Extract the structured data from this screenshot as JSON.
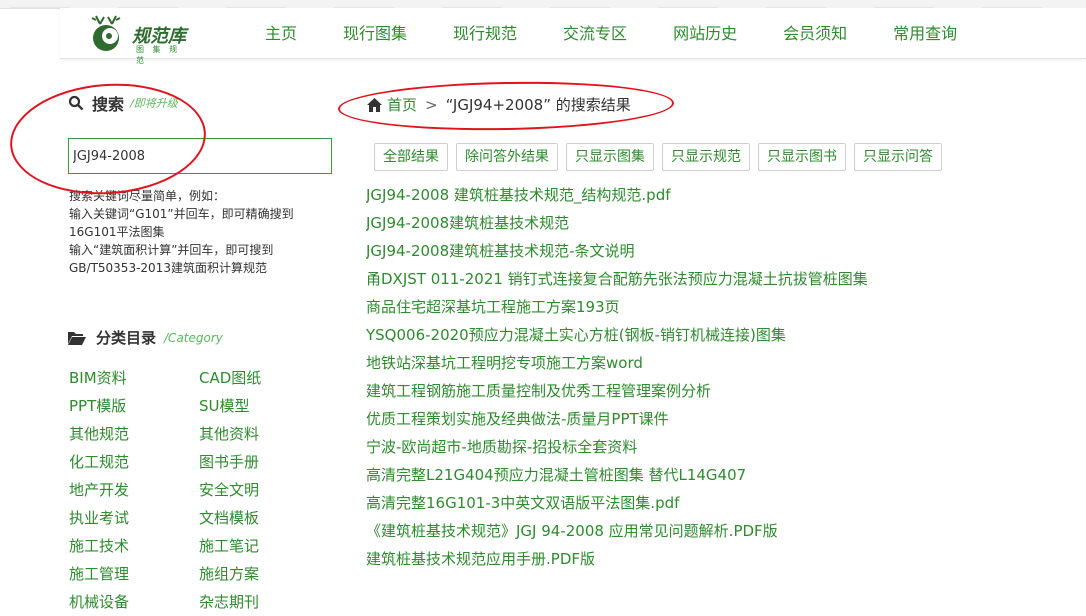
{
  "nav": {
    "logo_text": "规范库",
    "logo_sub": "图 集 规 范",
    "items": [
      "主页",
      "现行图集",
      "现行规范",
      "交流专区",
      "网站历史",
      "会员须知",
      "常用查询"
    ]
  },
  "search": {
    "title": "搜索",
    "subtitle": "/即将升级",
    "value": "JGJ94-2008",
    "tips": [
      "搜索关键词尽量简单，例如：",
      "输入关键词“G101”并回车，即可精确搜到16G101平法图集",
      "输入“建筑面积计算”并回车，即可搜到GB/T50353-2013建筑面积计算规范"
    ]
  },
  "categories": {
    "title": "分类目录",
    "subtitle": "/Category",
    "items": [
      "BIM资料",
      "CAD图纸",
      "PPT模版",
      "SU模型",
      "其他规范",
      "其他资料",
      "化工规范",
      "图书手册",
      "地产开发",
      "安全文明",
      "执业考试",
      "文档模板",
      "施工技术",
      "施工笔记",
      "施工管理",
      "施组方案",
      "机械设备",
      "杂志期刊"
    ]
  },
  "breadcrumb": {
    "home": "首页",
    "separator": ">",
    "query_text": "“JGJ94+2008” 的搜索结果"
  },
  "filters": [
    "全部结果",
    "除问答外结果",
    "只显示图集",
    "只显示规范",
    "只显示图书",
    "只显示问答"
  ],
  "results": [
    "JGJ94-2008 建筑桩基技术规范_结构规范.pdf",
    "JGJ94-2008建筑桩基技术规范",
    "JGJ94-2008建筑桩基技术规范-条文说明",
    "甬DXJST 011-2021 销钉式连接复合配筋先张法预应力混凝土抗拔管桩图集",
    "商品住宅超深基坑工程施工方案193页",
    "YSQ006-2020预应力混凝土实心方桩(钢板-销钉机械连接)图集",
    "地铁站深基坑工程明挖专项施工方案word",
    "建筑工程钢筋施工质量控制及优秀工程管理案例分析",
    "优质工程策划实施及经典做法-质量月PPT课件",
    "宁波-欧尚超市-地质勘探-招投标全套资料",
    "高清完整L21G404预应力混凝土管桩图集 替代L14G407",
    "高清完整16G101-3中英文双语版平法图集.pdf",
    "《建筑桩基技术规范》JGJ 94-2008 应用常见问题解析.PDF版",
    "建筑桩基技术规范应用手册.PDF版"
  ],
  "colors": {
    "link_green": "#2e8b2e",
    "accent_light_green": "#5cb85c",
    "annotation_red": "#e0141e"
  }
}
